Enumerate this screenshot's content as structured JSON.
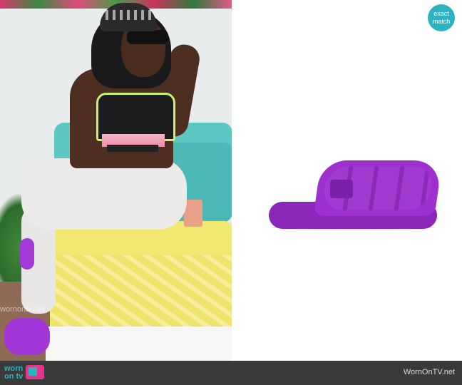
{
  "badge": {
    "line1": "exact",
    "line2": "match"
  },
  "scene_watermark": "wornontv.net",
  "footer": {
    "logo_line1": "worn",
    "logo_line2": "on tv",
    "site": "WornOnTV.net"
  },
  "icons": {
    "tv": "tv-icon"
  },
  "colors": {
    "accent": "#2bb3c1",
    "brand_pink": "#e8338a",
    "footer_bg": "#3a3a3a",
    "slide_purple": "#9d30cf"
  }
}
